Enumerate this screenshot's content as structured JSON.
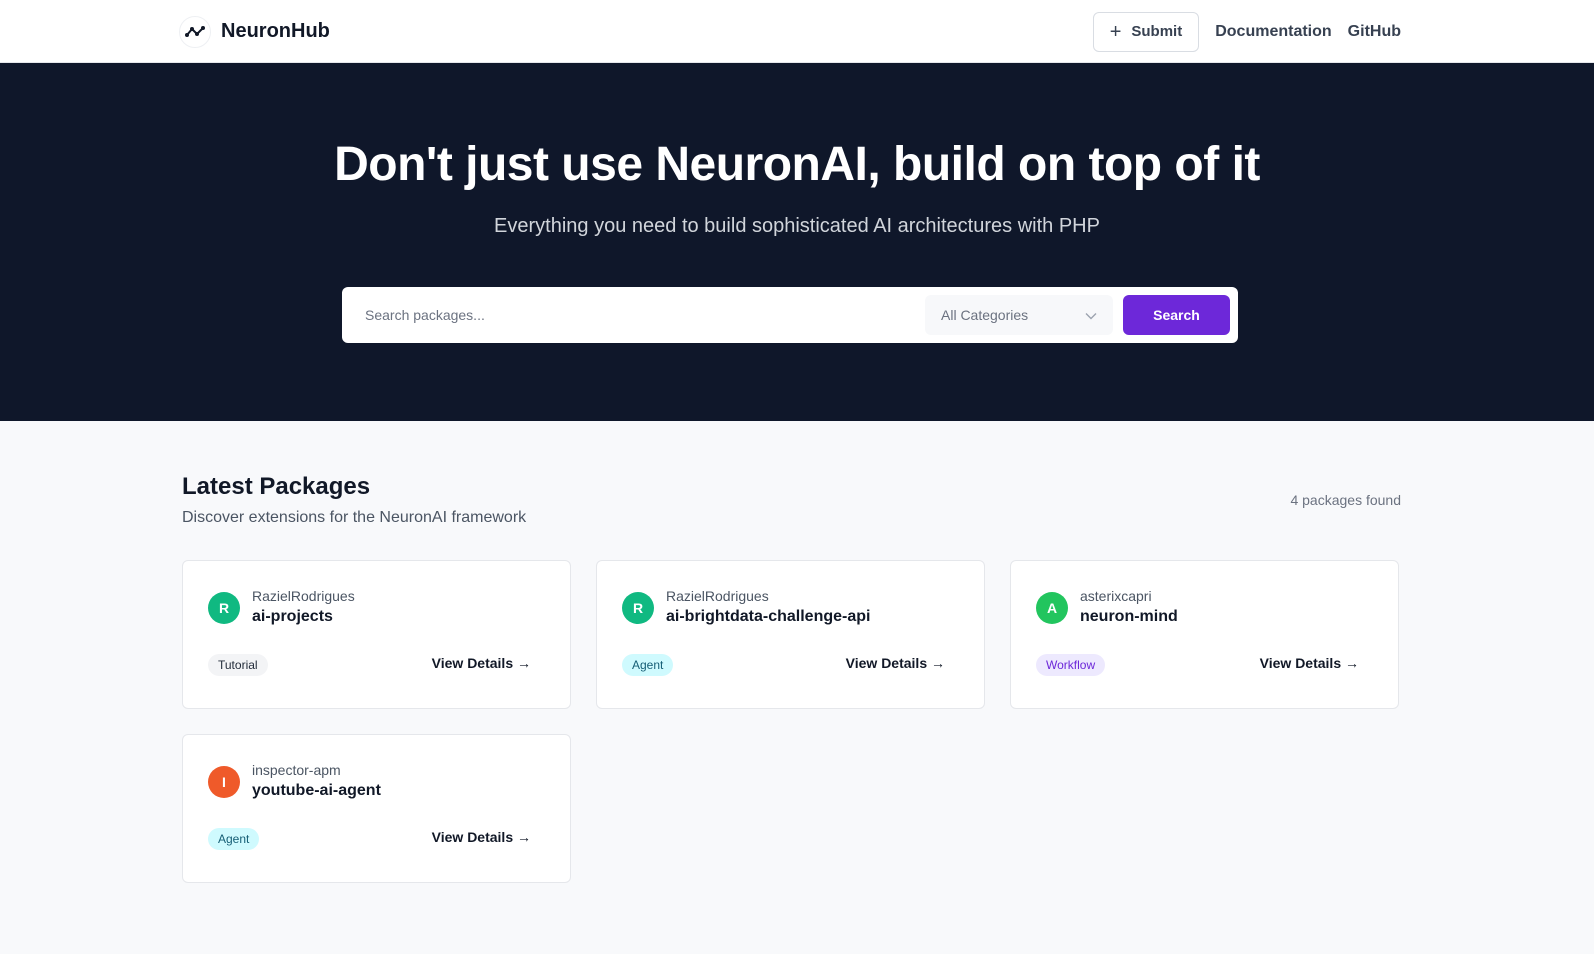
{
  "brand": {
    "name": "NeuronHub",
    "logo_icon": "neuron-graph-icon"
  },
  "nav": {
    "submit_label": "Submit",
    "submit_icon": "plus-icon",
    "documentation_label": "Documentation",
    "github_label": "GitHub"
  },
  "hero": {
    "title": "Don't just use NeuronAI, build on top of it",
    "subtitle": "Everything you need to build sophisticated AI architectures with PHP",
    "search_placeholder": "Search packages...",
    "category_value": "All Categories",
    "search_button": "Search"
  },
  "section": {
    "title": "Latest Packages",
    "subtitle": "Discover extensions for the NeuronAI framework",
    "count": "4 packages found"
  },
  "packages": [
    {
      "initial": "R",
      "avatar_color": "#10b981",
      "author": "RazielRodrigues",
      "name": "ai-projects",
      "category": "Tutorial",
      "badge_bg": "#f3f4f6",
      "badge_fg": "#1f2937",
      "link": "View Details →"
    },
    {
      "initial": "R",
      "avatar_color": "#10b981",
      "author": "RazielRodrigues",
      "name": "ai-brightdata-challenge-api",
      "category": "Agent",
      "badge_bg": "#cffafe",
      "badge_fg": "#155e75",
      "link": "View Details →"
    },
    {
      "initial": "A",
      "avatar_color": "#22c55e",
      "author": "asterixcapri",
      "name": "neuron-mind",
      "category": "Workflow",
      "badge_bg": "#ede9fe",
      "badge_fg": "#6d28d9",
      "link": "View Details →"
    },
    {
      "initial": "I",
      "avatar_color": "#ef5a2a",
      "author": "inspector-apm",
      "name": "youtube-ai-agent",
      "category": "Agent",
      "badge_bg": "#cffafe",
      "badge_fg": "#155e75",
      "link": "View Details →"
    }
  ],
  "colors": {
    "hero_bg": "#0f172a",
    "accent": "#6d28d9",
    "page_bg": "#f8f9fb"
  }
}
